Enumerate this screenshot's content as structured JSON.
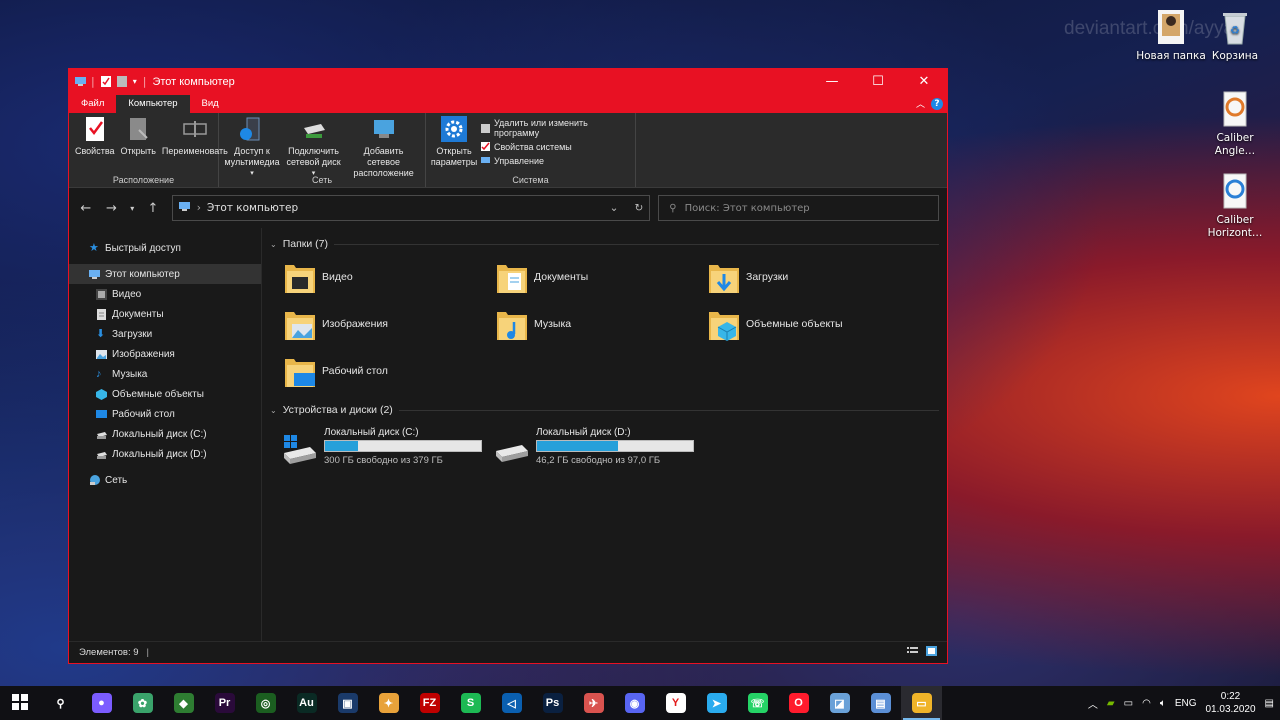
{
  "desktop": {
    "watermark": "deviantart.com/ayya",
    "icons": [
      {
        "label": "Новая папка"
      },
      {
        "label": "Корзина"
      },
      {
        "label": "Caliber Angle…"
      },
      {
        "label": "Caliber Horizont…"
      }
    ]
  },
  "window": {
    "title": "Этот компьютер",
    "controls": {
      "minimize": "—",
      "maximize": "☐",
      "close": "✕"
    },
    "tabs": [
      "Файл",
      "Компьютер",
      "Вид"
    ],
    "ribbon": {
      "groups": [
        {
          "label": "Расположение",
          "buttons": [
            "Свойства",
            "Открыть",
            "Переименовать"
          ]
        },
        {
          "label": "Сеть",
          "buttons": [
            "Доступ к мультимедиа",
            "Подключить сетевой диск",
            "Добавить сетевое расположение"
          ]
        },
        {
          "label": "Система",
          "buttons": [
            "Открыть параметры"
          ],
          "small": [
            "Удалить или изменить программу",
            "Свойства системы",
            "Управление"
          ]
        }
      ]
    },
    "address": {
      "path": "Этот компьютер",
      "search_placeholder": "Поиск: Этот компьютер"
    },
    "sidebar": [
      {
        "label": "Быстрый доступ",
        "icon": "star-icon",
        "indent": 0
      },
      {
        "label": "Этот компьютер",
        "icon": "computer-icon",
        "indent": 0,
        "selected": true
      },
      {
        "label": "Видео",
        "icon": "video-icon",
        "indent": 1
      },
      {
        "label": "Документы",
        "icon": "documents-icon",
        "indent": 1
      },
      {
        "label": "Загрузки",
        "icon": "downloads-icon",
        "indent": 1
      },
      {
        "label": "Изображения",
        "icon": "pictures-icon",
        "indent": 1
      },
      {
        "label": "Музыка",
        "icon": "music-icon",
        "indent": 1
      },
      {
        "label": "Объемные объекты",
        "icon": "3d-objects-icon",
        "indent": 1
      },
      {
        "label": "Рабочий стол",
        "icon": "desktop-icon",
        "indent": 1
      },
      {
        "label": "Локальный диск (C:)",
        "icon": "drive-c-icon",
        "indent": 1
      },
      {
        "label": "Локальный диск (D:)",
        "icon": "drive-d-icon",
        "indent": 1
      },
      {
        "label": "Сеть",
        "icon": "network-icon",
        "indent": 0
      }
    ],
    "folders_header": "Папки (7)",
    "folders": [
      {
        "label": "Видео",
        "overlay": "#2a2a2a"
      },
      {
        "label": "Документы",
        "overlay": "#ffffff"
      },
      {
        "label": "Загрузки",
        "overlay": "#1e88e5"
      },
      {
        "label": "Изображения",
        "overlay": "#4aa3df"
      },
      {
        "label": "Музыка",
        "overlay": "#1e88e5"
      },
      {
        "label": "Объемные объекты",
        "overlay": "#37b6e8"
      },
      {
        "label": "Рабочий стол",
        "overlay": "#1e88e5"
      }
    ],
    "drives_header": "Устройства и диски (2)",
    "drives": [
      {
        "name": "Локальный диск (C:)",
        "free": "300 ГБ свободно из 379 ГБ",
        "used_fraction": 0.21
      },
      {
        "name": "Локальный диск (D:)",
        "free": "46,2 ГБ свободно из 97,0 ГБ",
        "used_fraction": 0.52
      }
    ],
    "status": "Элементов: 9"
  },
  "taskbar": {
    "apps": [
      {
        "name": "search",
        "glyph": "⚲",
        "color": "transparent"
      },
      {
        "name": "alice",
        "glyph": "●",
        "color": "#7b5cff"
      },
      {
        "name": "app3",
        "glyph": "✿",
        "color": "#3aa36b"
      },
      {
        "name": "app4",
        "glyph": "◆",
        "color": "#2e7d32"
      },
      {
        "name": "premiere",
        "glyph": "Pr",
        "color": "#2a0a3a"
      },
      {
        "name": "app6",
        "glyph": "◎",
        "color": "#1b5e20"
      },
      {
        "name": "audition",
        "glyph": "Au",
        "color": "#0a2a24"
      },
      {
        "name": "virtualbox",
        "glyph": "▣",
        "color": "#1a3a6a"
      },
      {
        "name": "app9",
        "glyph": "✦",
        "color": "#e8a23a"
      },
      {
        "name": "filezilla",
        "glyph": "FZ",
        "color": "#bf0000"
      },
      {
        "name": "app11",
        "glyph": "S",
        "color": "#1db954"
      },
      {
        "name": "vscode",
        "glyph": "◁",
        "color": "#0a5fb0"
      },
      {
        "name": "photoshop",
        "glyph": "Ps",
        "color": "#0a2040"
      },
      {
        "name": "app14",
        "glyph": "✈",
        "color": "#d9534f"
      },
      {
        "name": "discord",
        "glyph": "◉",
        "color": "#5865f2"
      },
      {
        "name": "yandex",
        "glyph": "Y",
        "color": "#fff"
      },
      {
        "name": "telegram",
        "glyph": "➤",
        "color": "#2aabee"
      },
      {
        "name": "whatsapp",
        "glyph": "☏",
        "color": "#25d366"
      },
      {
        "name": "opera",
        "glyph": "O",
        "color": "#ff1b2d"
      },
      {
        "name": "app20",
        "glyph": "◪",
        "color": "#6aa1d8"
      },
      {
        "name": "app21",
        "glyph": "▤",
        "color": "#5b8fd6"
      },
      {
        "name": "explorer",
        "glyph": "▭",
        "color": "#f0b429",
        "active": true
      }
    ],
    "tray": {
      "lang": "ENG",
      "time": "0:22",
      "date": "01.03.2020"
    }
  }
}
